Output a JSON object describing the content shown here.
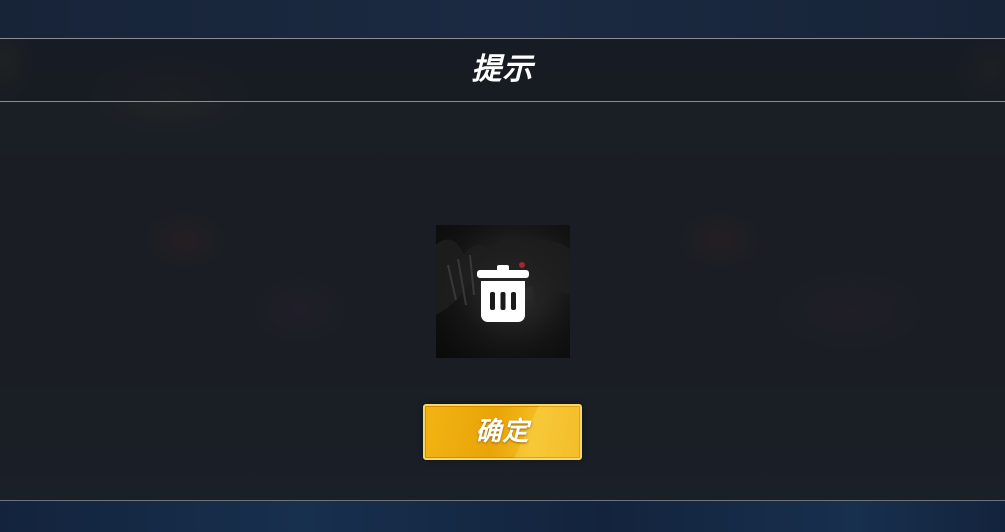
{
  "dialog": {
    "title": "提示",
    "confirm_label": "确定"
  },
  "item": {
    "icon": "trash-icon"
  },
  "colors": {
    "accent": "#f2b413",
    "background": "#1b1f26",
    "text": "#ffffff"
  }
}
